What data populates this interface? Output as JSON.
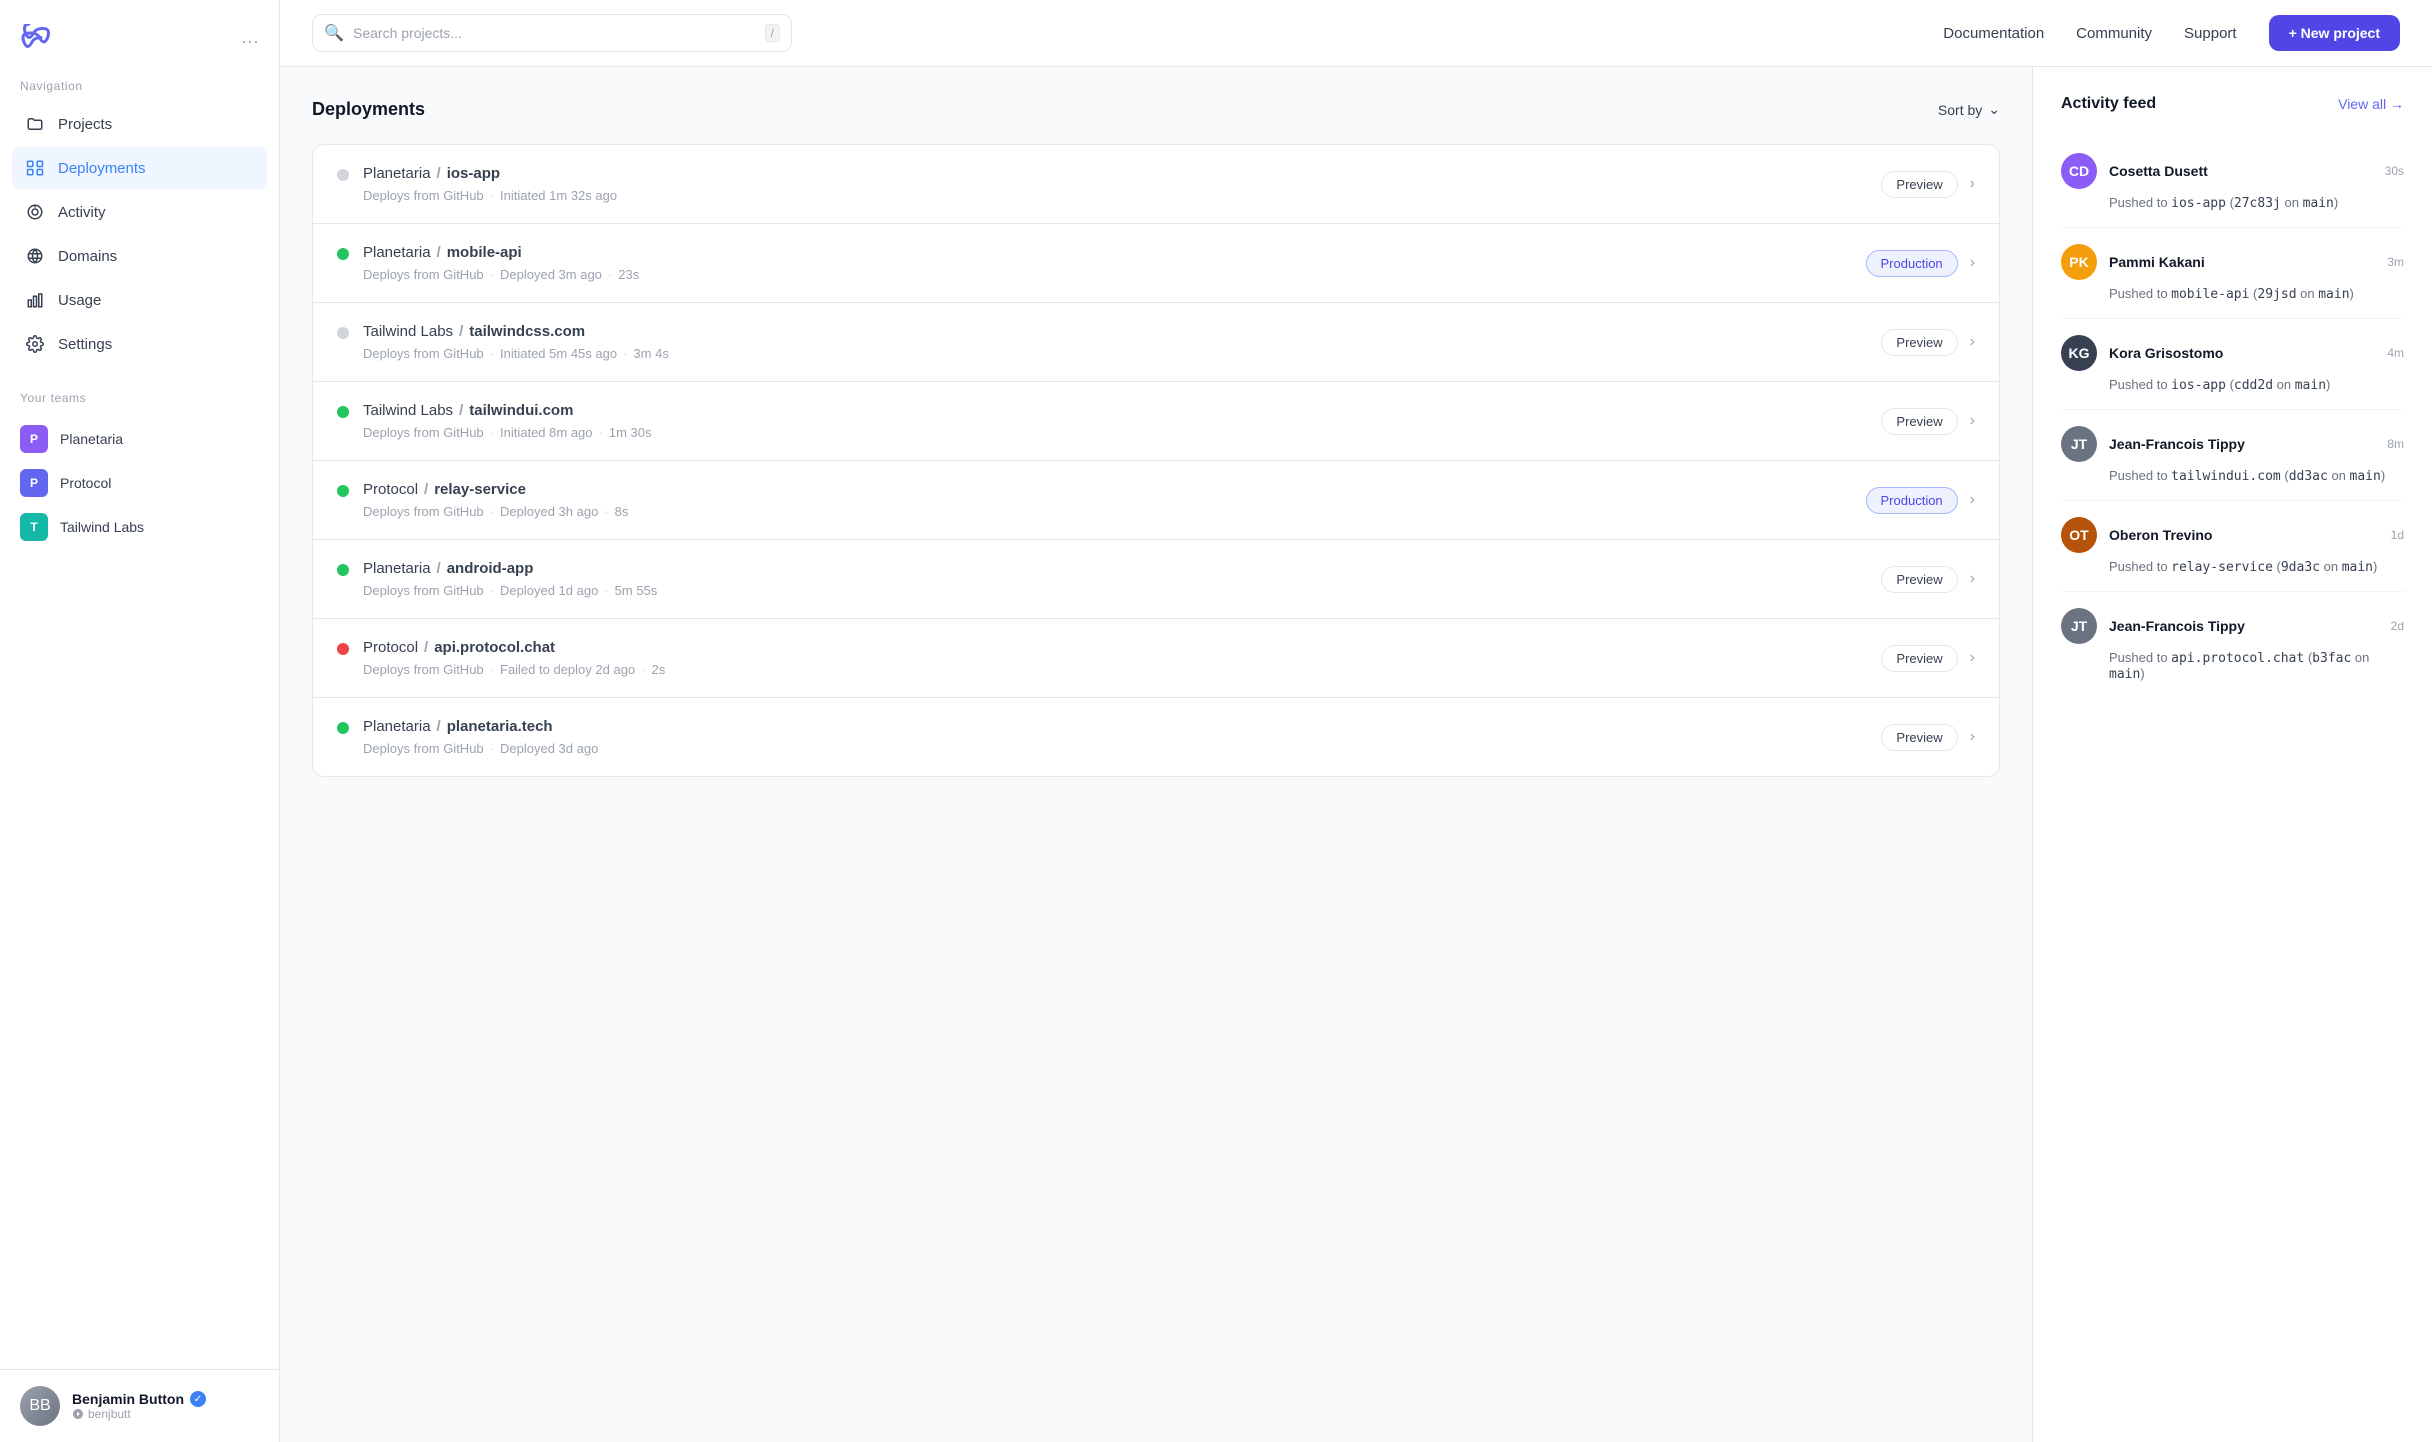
{
  "sidebar": {
    "navigation_label": "Navigation",
    "nav_items": [
      {
        "id": "projects",
        "label": "Projects",
        "icon": "folder"
      },
      {
        "id": "deployments",
        "label": "Deployments",
        "icon": "deployments",
        "active": true
      },
      {
        "id": "activity",
        "label": "Activity",
        "icon": "activity"
      },
      {
        "id": "domains",
        "label": "Domains",
        "icon": "globe"
      },
      {
        "id": "usage",
        "label": "Usage",
        "icon": "bar-chart"
      },
      {
        "id": "settings",
        "label": "Settings",
        "icon": "settings"
      }
    ],
    "teams_label": "Your teams",
    "teams": [
      {
        "id": "planetaria",
        "label": "Planetaria",
        "abbr": "P",
        "color": "purple"
      },
      {
        "id": "protocol",
        "label": "Protocol",
        "abbr": "P",
        "color": "indigo"
      },
      {
        "id": "tailwind",
        "label": "Tailwind Labs",
        "abbr": "T",
        "color": "teal"
      }
    ],
    "user": {
      "name": "Benjamin Button",
      "handle": "benjbutt",
      "verified": true
    }
  },
  "topbar": {
    "search_placeholder": "Search projects...",
    "search_shortcut": "/",
    "nav_links": [
      {
        "id": "documentation",
        "label": "Documentation"
      },
      {
        "id": "community",
        "label": "Community"
      },
      {
        "id": "support",
        "label": "Support"
      }
    ],
    "new_project_label": "+ New project"
  },
  "deployments": {
    "title": "Deployments",
    "sort_by_label": "Sort by",
    "items": [
      {
        "project": "Planetaria",
        "repo": "ios-app",
        "status": "gray",
        "source": "Deploys from GitHub",
        "time": "Initiated 1m 32s ago",
        "duration": null,
        "badge": "Preview",
        "badge_type": "preview"
      },
      {
        "project": "Planetaria",
        "repo": "mobile-api",
        "status": "green",
        "source": "Deploys from GitHub",
        "time": "Deployed 3m ago",
        "duration": "23s",
        "badge": "Production",
        "badge_type": "production"
      },
      {
        "project": "Tailwind Labs",
        "repo": "tailwindcss.com",
        "status": "gray",
        "source": "Deploys from GitHub",
        "time": "Initiated 5m 45s ago",
        "duration": "3m 4s",
        "badge": "Preview",
        "badge_type": "preview"
      },
      {
        "project": "Tailwind Labs",
        "repo": "tailwindui.com",
        "status": "green",
        "source": "Deploys from GitHub",
        "time": "Initiated 8m ago",
        "duration": "1m 30s",
        "badge": "Preview",
        "badge_type": "preview"
      },
      {
        "project": "Protocol",
        "repo": "relay-service",
        "status": "green",
        "source": "Deploys from GitHub",
        "time": "Deployed 3h ago",
        "duration": "8s",
        "badge": "Production",
        "badge_type": "production"
      },
      {
        "project": "Planetaria",
        "repo": "android-app",
        "status": "green",
        "source": "Deploys from GitHub",
        "time": "Deployed 1d ago",
        "duration": "5m 55s",
        "badge": "Preview",
        "badge_type": "preview"
      },
      {
        "project": "Protocol",
        "repo": "api.protocol.chat",
        "status": "red",
        "source": "Deploys from GitHub",
        "time": "Failed to deploy 2d ago",
        "duration": "2s",
        "badge": "Preview",
        "badge_type": "preview"
      },
      {
        "project": "Planetaria",
        "repo": "planetaria.tech",
        "status": "green",
        "source": "Deploys from GitHub",
        "time": "Deployed 3d ago",
        "duration": null,
        "badge": "Preview",
        "badge_type": "preview"
      }
    ]
  },
  "activity": {
    "title": "Activity feed",
    "view_all_label": "View all →",
    "items": [
      {
        "user": "Cosetta Dusett",
        "time": "30s",
        "desc_prefix": "Pushed to",
        "target": "ios-app",
        "hash": "27c83j",
        "branch": "main",
        "avatar_color": "#8b5cf6",
        "avatar_initials": "CD"
      },
      {
        "user": "Pammi Kakani",
        "time": "3m",
        "desc_prefix": "Pushed to",
        "target": "mobile-api",
        "hash": "29jsd",
        "branch": "main",
        "avatar_color": "#f59e0b",
        "avatar_initials": "PK"
      },
      {
        "user": "Kora Grisostomo",
        "time": "4m",
        "desc_prefix": "Pushed to",
        "target": "ios-app",
        "hash": "cdd2d",
        "branch": "main",
        "avatar_color": "#374151",
        "avatar_initials": "KG"
      },
      {
        "user": "Jean-Francois Tippy",
        "time": "8m",
        "desc_prefix": "Pushed to",
        "target": "tailwindui.com",
        "hash": "dd3ac",
        "branch": "main",
        "avatar_color": "#6b7280",
        "avatar_initials": "JT"
      },
      {
        "user": "Oberon Trevino",
        "time": "1d",
        "desc_prefix": "Pushed to",
        "target": "relay-service",
        "hash": "9da3c",
        "branch": "main",
        "avatar_color": "#b45309",
        "avatar_initials": "OT"
      },
      {
        "user": "Jean-Francois Tippy",
        "time": "2d",
        "desc_prefix": "Pushed to",
        "target": "api.protocol.chat",
        "hash": "b3fac",
        "branch": "main",
        "avatar_color": "#6b7280",
        "avatar_initials": "JT"
      }
    ]
  }
}
